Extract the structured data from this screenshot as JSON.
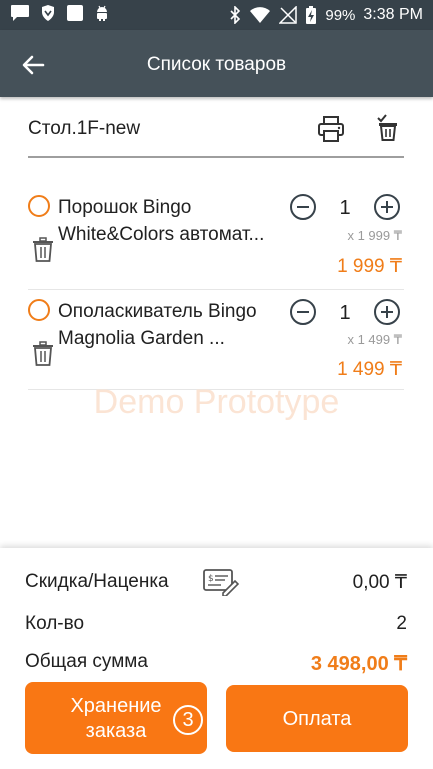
{
  "status_bar": {
    "battery": "99%",
    "time": "3:38 PM",
    "icons": [
      "message-icon",
      "shield-icon",
      "square-app-icon",
      "android-icon",
      "bluetooth-icon",
      "wifi-icon",
      "no-signal-icon",
      "battery-charging-icon"
    ]
  },
  "app_bar": {
    "title": "Список товаров",
    "back_icon": "arrow-left-icon"
  },
  "order": {
    "name": "Стол.1F-new",
    "print_icon": "printer-icon",
    "delete_icon": "trash-check-icon"
  },
  "items": [
    {
      "name": "Порошок Bingo\nWhite&Colors автомат...",
      "quantity": "1",
      "unit_price": "x 1 999 ₸",
      "line_total": "1 999 ₸"
    },
    {
      "name": "Ополаскиватель Bingo\nMagnolia Garden ...",
      "quantity": "1",
      "unit_price": "x 1 499 ₸",
      "line_total": "1 499 ₸"
    }
  ],
  "watermark": "Demo Prototype",
  "summary": {
    "discount_label": "Скидка/Наценка",
    "discount_value": "0,00 ₸",
    "qty_label": "Кол-во",
    "qty_value": "2",
    "total_label": "Общая сумма",
    "total_value": "3 498,00 ₸"
  },
  "buttons": {
    "save_label": "Хранение\nзаказа",
    "save_badge": "3",
    "pay_label": "Оплата"
  },
  "colors": {
    "accent": "#f97714",
    "app_bar": "#455159",
    "status_bar": "#37424a"
  }
}
